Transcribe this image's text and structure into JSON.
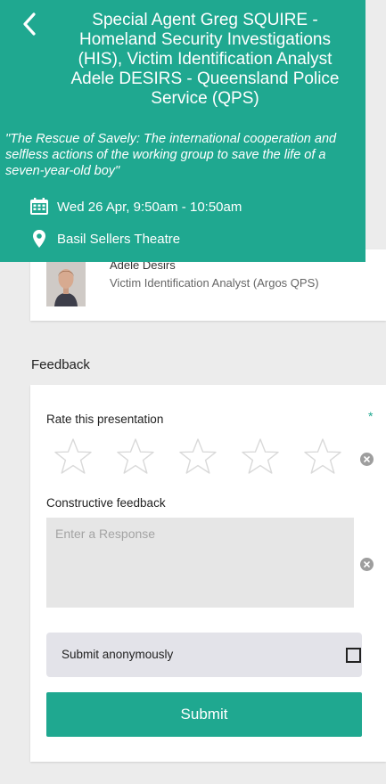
{
  "header": {
    "title": "Special Agent Greg SQUIRE - Homeland Security Investigations (HIS), Victim Identification Analyst Adele DESIRS - Queensland Police Service (QPS)",
    "description": "\"The Rescue of Savely: The international cooperation and selfless actions of the working group to save the life of a seven-year-old boy\"",
    "date": "Wed 26 Apr, 9:50am - 10:50am",
    "venue": "Basil Sellers Theatre",
    "background_color": "#1fa890"
  },
  "speaker": {
    "name": "Adele Desirs",
    "role": "Victim Identification Analyst (Argos QPS)"
  },
  "feedback": {
    "section_title": "Feedback",
    "rate_label": "Rate this presentation",
    "required_marker": "*",
    "rating": 0,
    "max_rating": 5,
    "text_label": "Constructive feedback",
    "text_value": "",
    "text_placeholder": "Enter a Response",
    "anonymous_label": "Submit anonymously",
    "anonymous_checked": false,
    "submit_label": "Submit",
    "accent_color": "#1fa890"
  }
}
